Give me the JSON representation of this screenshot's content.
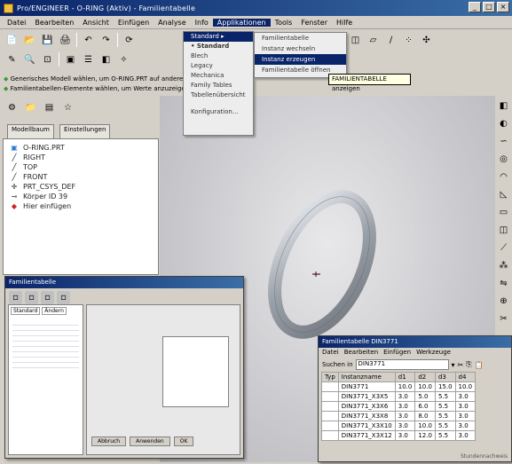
{
  "app": {
    "title": "Pro/ENGINEER - O-RING (Aktiv) - Familientabelle"
  },
  "menu": [
    "Datei",
    "Bearbeiten",
    "Ansicht",
    "Einfügen",
    "Analyse",
    "Info",
    "Applikationen",
    "Tools",
    "Fenster",
    "Hilfe"
  ],
  "message": {
    "line1": "Generisches Modell wählen, um O-RING.PRT auf andere Modelle anzuwenden",
    "line2": "Familientabellen-Elemente wählen, um Werte anzuzeigen"
  },
  "tooltip": "FAMILIENTABELLE anzeigen",
  "dropdown": {
    "items": [
      "Standard",
      "Blech",
      "Legacy",
      "Mechanica",
      "Family Tables",
      "Tabellenübersicht",
      "Konfiguration..."
    ],
    "selected_header": "Standard"
  },
  "submenu": {
    "items": [
      "Familientabelle",
      "Instanz wechseln",
      "Instanz erzeugen",
      "Familientabelle öffnen"
    ],
    "selected_index": 2
  },
  "navtabs": [
    "Modellbaum",
    "Einstellungen"
  ],
  "tree": [
    {
      "icon": "part",
      "label": "O-RING.PRT"
    },
    {
      "icon": "plane",
      "label": "RIGHT"
    },
    {
      "icon": "plane",
      "label": "TOP"
    },
    {
      "icon": "plane",
      "label": "FRONT"
    },
    {
      "icon": "csys",
      "label": "PRT_CSYS_DEF"
    },
    {
      "icon": "feature",
      "label": "Körper ID 39"
    },
    {
      "icon": "insert",
      "label": "Hier einfügen"
    }
  ],
  "family_table": {
    "title": "Familientabelle DIN3771",
    "menu": [
      "Datei",
      "Bearbeiten",
      "Einfügen",
      "Werkzeuge"
    ],
    "search_label": "Suchen in",
    "search_value": "DIN3771",
    "columns": [
      "Typ",
      "Instanzname",
      "d1",
      "d2",
      "d3",
      "d4"
    ],
    "rows": [
      [
        "",
        "DIN3771",
        "10.0",
        "10.0",
        "15.0",
        "10.0"
      ],
      [
        "",
        "DIN3771_X3X5",
        "3.0",
        "5.0",
        "5.5",
        "3.0"
      ],
      [
        "",
        "DIN3771_X3X6",
        "3.0",
        "6.0",
        "5.5",
        "3.0"
      ],
      [
        "",
        "DIN3771_X3X8",
        "3.0",
        "8.0",
        "5.5",
        "3.0"
      ],
      [
        "",
        "DIN3771_X3X10",
        "3.0",
        "10.0",
        "5.5",
        "3.0"
      ],
      [
        "",
        "DIN3771_X3X12",
        "3.0",
        "12.0",
        "5.5",
        "3.0"
      ]
    ],
    "footer": "Stundennachweis"
  },
  "small_window": {
    "title": "Familientabelle",
    "tabs": [
      "Standard",
      "Ändern"
    ],
    "buttons": [
      "Abbruch",
      "Anwenden",
      "OK"
    ]
  }
}
